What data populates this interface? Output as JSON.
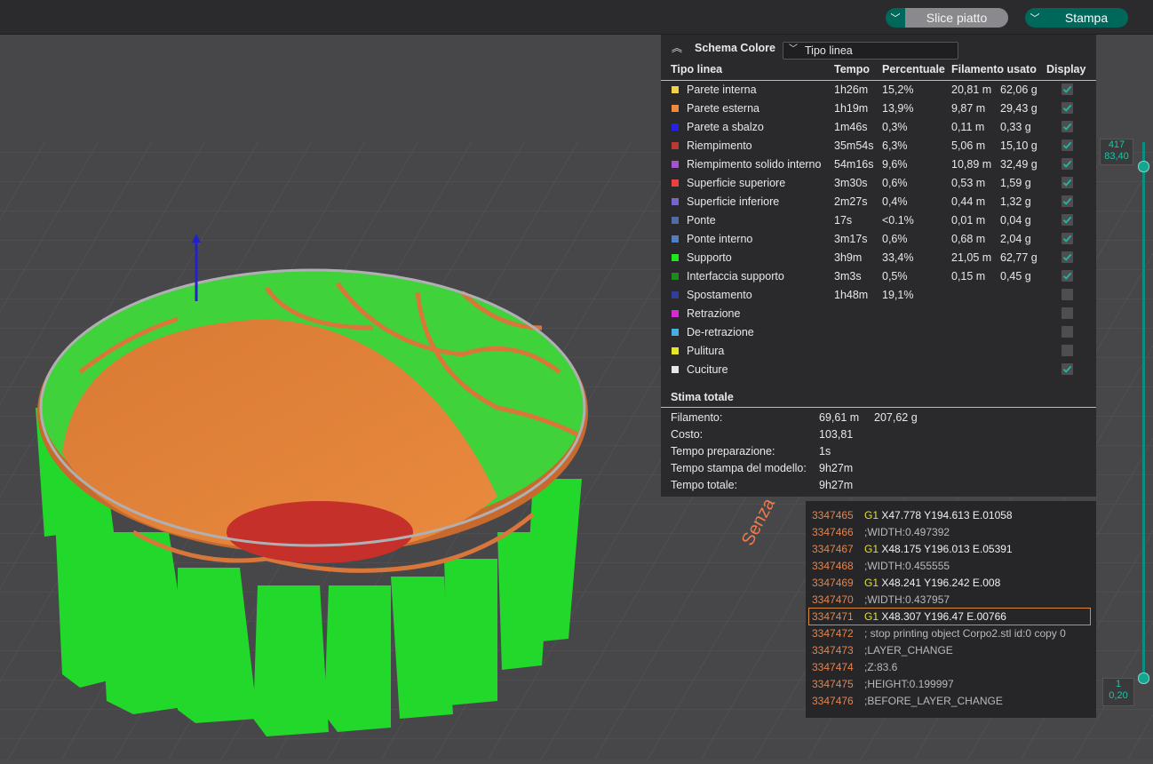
{
  "toolbar": {
    "slice_label": "Slice piatto",
    "print_label": "Stampa",
    "dropdown_icon": "chevron-down-icon"
  },
  "colors": {
    "accent": "#00675b",
    "support": "#22e62a",
    "wall": "#e5762f",
    "infill": "#c8312a"
  },
  "viewport": {
    "object_label": "Senza titolo"
  },
  "legend": {
    "title": "Schema Colore",
    "scheme_value": "Tipo linea",
    "columns": [
      "Tipo linea",
      "Tempo",
      "Percentuale",
      "Filamento usato",
      "Display"
    ],
    "rows": [
      {
        "color": "#f2d04a",
        "name": "Parete interna",
        "time": "1h26m",
        "pct": "15,2%",
        "len": "20,81 m",
        "weight": "62,06 g",
        "checked": true
      },
      {
        "color": "#ef8a3c",
        "name": "Parete esterna",
        "time": "1h19m",
        "pct": "13,9%",
        "len": "9,87 m",
        "weight": "29,43 g",
        "checked": true
      },
      {
        "color": "#2323e6",
        "name": "Parete a sbalzo",
        "time": "1m46s",
        "pct": "0,3%",
        "len": "0,11 m",
        "weight": "0,33 g",
        "checked": true
      },
      {
        "color": "#b83a33",
        "name": "Riempimento",
        "time": "35m54s",
        "pct": "6,3%",
        "len": "5,06 m",
        "weight": "15,10 g",
        "checked": true
      },
      {
        "color": "#a553c9",
        "name": "Riempimento solido interno",
        "time": "54m16s",
        "pct": "9,6%",
        "len": "10,89 m",
        "weight": "32,49 g",
        "checked": true
      },
      {
        "color": "#e94040",
        "name": "Superficie superiore",
        "time": "3m30s",
        "pct": "0,6%",
        "len": "0,53 m",
        "weight": "1,59 g",
        "checked": true
      },
      {
        "color": "#7566c9",
        "name": "Superficie inferiore",
        "time": "2m27s",
        "pct": "0,4%",
        "len": "0,44 m",
        "weight": "1,32 g",
        "checked": true
      },
      {
        "color": "#4f6ba8",
        "name": "Ponte",
        "time": "17s",
        "pct": "<0.1%",
        "len": "0,01 m",
        "weight": "0,04 g",
        "checked": true
      },
      {
        "color": "#4f7ec0",
        "name": "Ponte interno",
        "time": "3m17s",
        "pct": "0,6%",
        "len": "0,68 m",
        "weight": "2,04 g",
        "checked": true
      },
      {
        "color": "#1de81d",
        "name": "Supporto",
        "time": "3h9m",
        "pct": "33,4%",
        "len": "21,05 m",
        "weight": "62,77 g",
        "checked": true
      },
      {
        "color": "#1c8a1c",
        "name": "Interfaccia supporto",
        "time": "3m3s",
        "pct": "0,5%",
        "len": "0,15 m",
        "weight": "0,45 g",
        "checked": true
      },
      {
        "color": "#2f3f9a",
        "name": "Spostamento",
        "time": "1h48m",
        "pct": "19,1%",
        "len": "",
        "weight": "",
        "checked": false
      },
      {
        "color": "#d22bd2",
        "name": "Retrazione",
        "time": "",
        "pct": "",
        "len": "",
        "weight": "",
        "checked": false
      },
      {
        "color": "#46aee0",
        "name": "De-retrazione",
        "time": "",
        "pct": "",
        "len": "",
        "weight": "",
        "checked": false
      },
      {
        "color": "#e6e626",
        "name": "Pulitura",
        "time": "",
        "pct": "",
        "len": "",
        "weight": "",
        "checked": false
      },
      {
        "color": "#e6e6e6",
        "name": "Cuciture",
        "time": "",
        "pct": "",
        "len": "",
        "weight": "",
        "checked": true
      }
    ],
    "totals": {
      "title": "Stima totale",
      "filament_label": "Filamento:",
      "filament_len": "69,61 m",
      "filament_weight": "207,62 g",
      "cost_label": "Costo:",
      "cost": "103,81",
      "prep_label": "Tempo preparazione:",
      "prep": "1s",
      "model_label": "Tempo stampa del modello:",
      "model": "9h27m",
      "total_label": "Tempo totale:",
      "total": "9h27m"
    }
  },
  "gcode": {
    "lines": [
      {
        "n": "3347465",
        "cmd": "G1",
        "args": "X47.778 Y194.613 E.01058",
        "comment": ""
      },
      {
        "n": "3347466",
        "cmd": "",
        "args": "",
        "comment": ";WIDTH:0.497392"
      },
      {
        "n": "3347467",
        "cmd": "G1",
        "args": "X48.175 Y196.013 E.05391",
        "comment": ""
      },
      {
        "n": "3347468",
        "cmd": "",
        "args": "",
        "comment": ";WIDTH:0.455555"
      },
      {
        "n": "3347469",
        "cmd": "G1",
        "args": "X48.241 Y196.242 E.008",
        "comment": ""
      },
      {
        "n": "3347470",
        "cmd": "",
        "args": "",
        "comment": ";WIDTH:0.437957"
      },
      {
        "n": "3347471",
        "cmd": "G1",
        "args": "X48.307 Y196.47 E.00766",
        "comment": ""
      },
      {
        "n": "3347472",
        "cmd": "",
        "args": "",
        "comment": "; stop printing object Corpo2.stl id:0 copy 0"
      },
      {
        "n": "3347473",
        "cmd": "",
        "args": "",
        "comment": ";LAYER_CHANGE"
      },
      {
        "n": "3347474",
        "cmd": "",
        "args": "",
        "comment": ";Z:83.6"
      },
      {
        "n": "3347475",
        "cmd": "",
        "args": "",
        "comment": ";HEIGHT:0.199997"
      },
      {
        "n": "3347476",
        "cmd": "",
        "args": "",
        "comment": ";BEFORE_LAYER_CHANGE"
      }
    ],
    "selected_index": 6
  },
  "layer_slider": {
    "top_layer": "417",
    "top_height": "83,40",
    "bottom_layer": "1",
    "bottom_height": "0,20"
  }
}
